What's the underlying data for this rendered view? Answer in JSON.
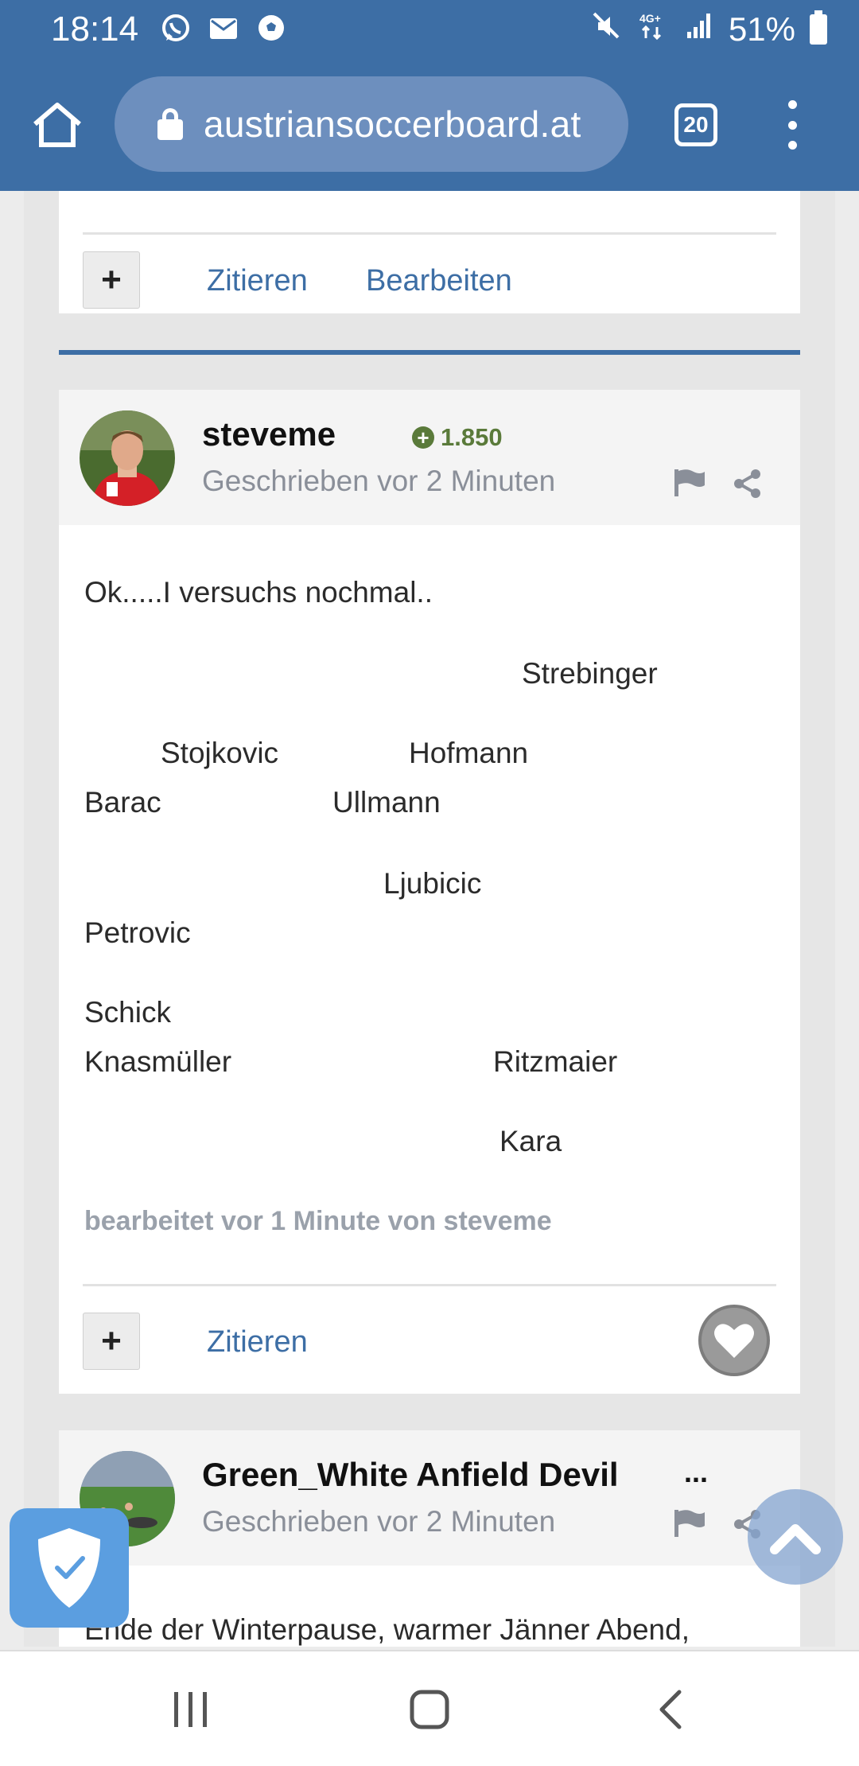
{
  "status_bar": {
    "time": "18:14",
    "battery": "51%",
    "icons_left": [
      "whatsapp-icon",
      "mail-icon",
      "soccer-icon"
    ],
    "icons_right": [
      "mute-icon",
      "4g-icon",
      "signal-icon",
      "battery-icon"
    ]
  },
  "browser": {
    "url": "austriansoccerboard.at",
    "tab_count": "20"
  },
  "prev_post": {
    "quote_label": "Zitieren",
    "edit_label": "Bearbeiten"
  },
  "post": {
    "username": "steveme",
    "reputation": "1.850",
    "timestamp": "Geschrieben vor 2 Minuten",
    "lines": [
      "Ok.....I versuchs nochmal..",
      "Strebinger",
      "Stojkovic",
      "Hofmann",
      "Barac",
      "Ullmann",
      "Ljubicic",
      "Petrovic",
      "Schick",
      "Knasmüller",
      "Ritzmaier",
      "Kara"
    ],
    "edited_note": "bearbeitet vor 1 Minute von steveme",
    "quote_label": "Zitieren"
  },
  "next_post": {
    "username": "Green_White Anfield Devil",
    "ellipsis": "...",
    "timestamp": "Geschrieben vor 2 Minuten",
    "text": "Ende der Winterpause, warmer Jänner Abend,"
  },
  "colors": {
    "header": "#3d6ea5",
    "link": "#3d6ea5",
    "reputation": "#5a7a3a"
  }
}
